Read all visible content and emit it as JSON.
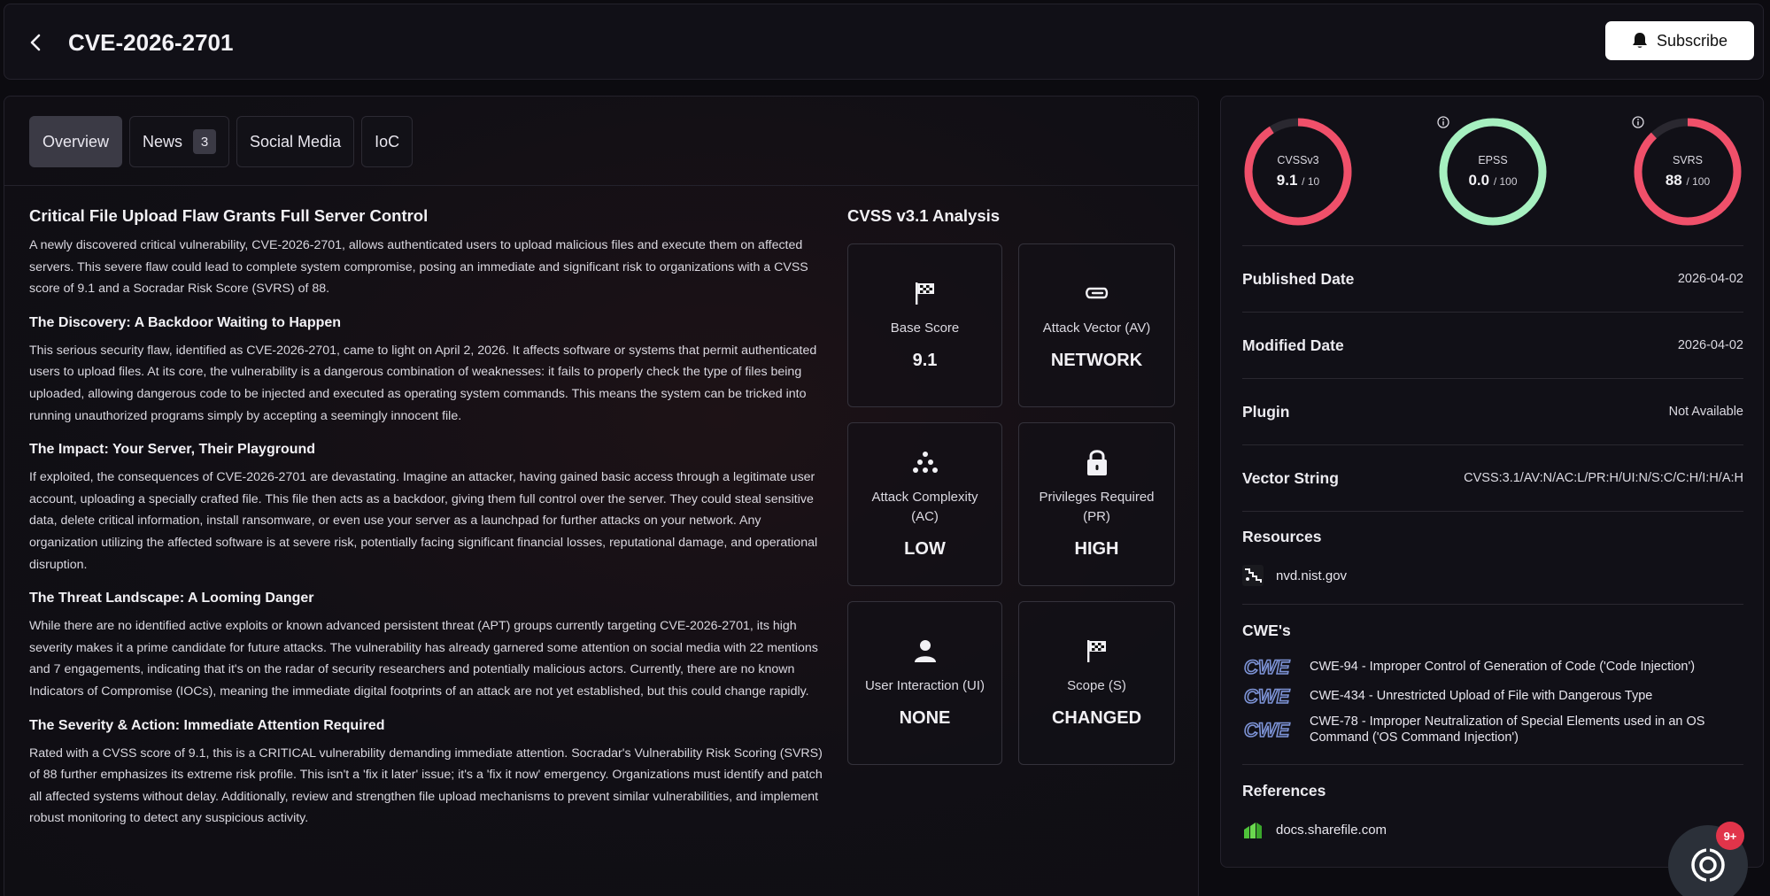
{
  "header": {
    "title": "CVE-2026-2701",
    "subscribe_label": "Subscribe"
  },
  "tabs": [
    {
      "label": "Overview",
      "active": true
    },
    {
      "label": "News",
      "badge": "3"
    },
    {
      "label": "Social Media"
    },
    {
      "label": "IoC"
    }
  ],
  "article": {
    "title": "Critical File Upload Flaw Grants Full Server Control",
    "intro": "A newly discovered critical vulnerability, CVE-2026-2701, allows authenticated users to upload malicious files and execute them on affected servers. This severe flaw could lead to complete system compromise, posing an immediate and significant risk to organizations with a CVSS score of 9.1 and a Socradar Risk Score (SVRS) of 88.",
    "sections": [
      {
        "heading": "The Discovery: A Backdoor Waiting to Happen",
        "body": "This serious security flaw, identified as CVE-2026-2701, came to light on April 2, 2026. It affects software or systems that permit authenticated users to upload files. At its core, the vulnerability is a dangerous combination of weaknesses: it fails to properly check the type of files being uploaded, allowing dangerous code to be injected and executed as operating system commands. This means the system can be tricked into running unauthorized programs simply by accepting a seemingly innocent file."
      },
      {
        "heading": "The Impact: Your Server, Their Playground",
        "body": "If exploited, the consequences of CVE-2026-2701 are devastating. Imagine an attacker, having gained basic access through a legitimate user account, uploading a specially crafted file. This file then acts as a backdoor, giving them full control over the server. They could steal sensitive data, delete critical information, install ransomware, or even use your server as a launchpad for further attacks on your network. Any organization utilizing the affected software is at severe risk, potentially facing significant financial losses, reputational damage, and operational disruption."
      },
      {
        "heading": "The Threat Landscape: A Looming Danger",
        "body": "While there are no identified active exploits or known advanced persistent threat (APT) groups currently targeting CVE-2026-2701, its high severity makes it a prime candidate for future attacks. The vulnerability has already garnered some attention on social media with 22 mentions and 7 engagements, indicating that it's on the radar of security researchers and potentially malicious actors. Currently, there are no known Indicators of Compromise (IOCs), meaning the immediate digital footprints of an attack are not yet established, but this could change rapidly."
      },
      {
        "heading": "The Severity & Action: Immediate Attention Required",
        "body": "Rated with a CVSS score of 9.1, this is a CRITICAL vulnerability demanding immediate attention. Socradar's Vulnerability Risk Scoring (SVRS) of 88 further emphasizes its extreme risk profile. This isn't a 'fix it later' issue; it's a 'fix it now' emergency. Organizations must identify and patch all affected systems without delay. Additionally, review and strengthen file upload mechanisms to prevent similar vulnerabilities, and implement robust monitoring to detect any suspicious activity."
      }
    ]
  },
  "cvss": {
    "title": "CVSS v3.1 Analysis",
    "metrics": [
      {
        "label": "Base Score",
        "value": "9.1",
        "icon": "flag-icon"
      },
      {
        "label": "Attack Vector (AV)",
        "value": "NETWORK",
        "icon": "paperclip-icon"
      },
      {
        "label": "Attack Complexity (AC)",
        "value": "LOW",
        "icon": "dots-cluster-icon"
      },
      {
        "label": "Privileges Required (PR)",
        "value": "HIGH",
        "icon": "lock-icon"
      },
      {
        "label": "User Interaction (UI)",
        "value": "NONE",
        "icon": "user-icon"
      },
      {
        "label": "Scope (S)",
        "value": "CHANGED",
        "icon": "flag-icon"
      }
    ]
  },
  "scores": [
    {
      "name": "CVSSv3",
      "value": "9.1",
      "max": "/ 10",
      "fraction": 0.91,
      "color": "#f0506a",
      "info": false
    },
    {
      "name": "EPSS",
      "value": "0.0",
      "max": "/ 100",
      "fraction": 0.0,
      "color": "#a6f0c0",
      "info": true
    },
    {
      "name": "SVRS",
      "value": "88",
      "max": "/ 100",
      "fraction": 0.88,
      "color": "#f0506a",
      "info": true
    }
  ],
  "details": [
    {
      "label": "Published Date",
      "value": "2026-04-02"
    },
    {
      "label": "Modified Date",
      "value": "2026-04-02"
    },
    {
      "label": "Plugin",
      "value": "Not Available"
    },
    {
      "label": "Vector String",
      "value": "CVSS:3.1/AV:N/AC:L/PR:H/UI:N/S:C/C:H/I:H/A:H"
    }
  ],
  "resources": {
    "title": "Resources",
    "items": [
      {
        "label": "nvd.nist.gov",
        "icon": "nvd-logo-icon"
      }
    ]
  },
  "cwes": {
    "title": "CWE's",
    "logo_text": "CWE",
    "items": [
      {
        "label": "CWE-94 - Improper Control of Generation of Code ('Code Injection')"
      },
      {
        "label": "CWE-434 - Unrestricted Upload of File with Dangerous Type"
      },
      {
        "label": "CWE-78 - Improper Neutralization of Special Elements used in an OS Command ('OS Command Injection')"
      }
    ]
  },
  "references": {
    "title": "References",
    "items": [
      {
        "label": "docs.sharefile.com",
        "icon": "sharefile-logo-icon"
      }
    ]
  },
  "chat": {
    "badge": "9+"
  },
  "colors": {
    "accent_red": "#f0506a",
    "accent_green": "#a6f0c0"
  }
}
